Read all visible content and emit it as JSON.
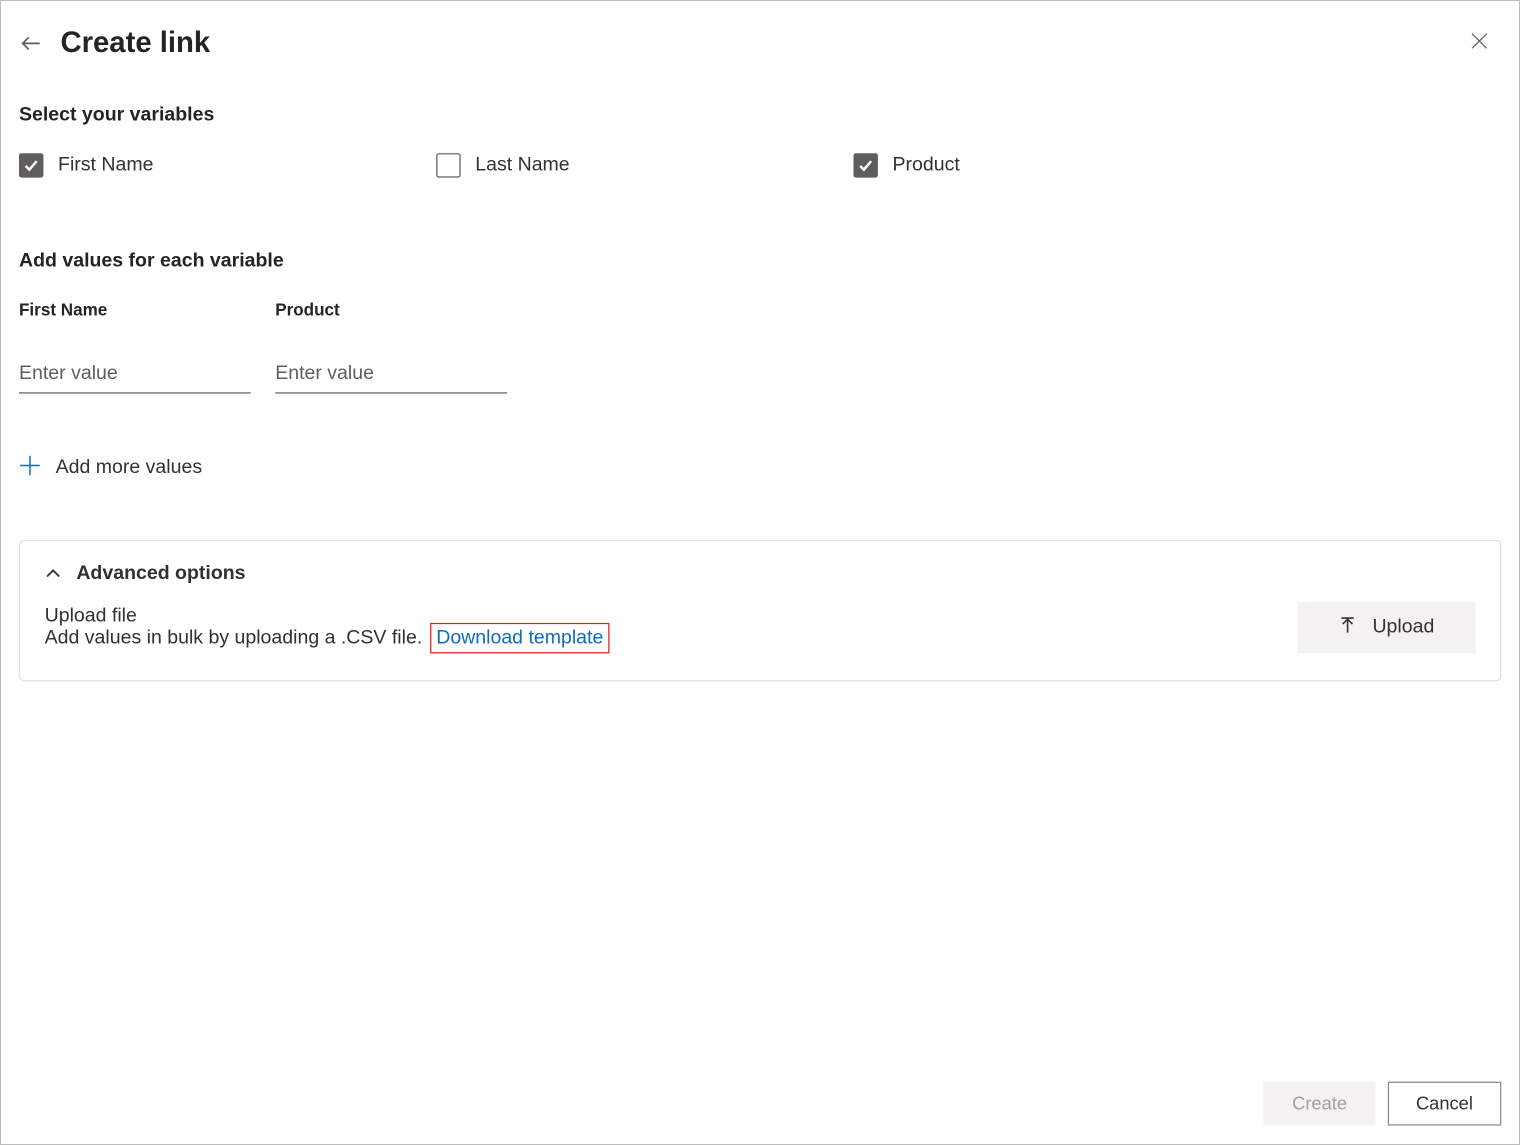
{
  "header": {
    "title": "Create link"
  },
  "sections": {
    "select_variables": "Select your variables",
    "add_values": "Add values for each variable"
  },
  "variables": [
    {
      "label": "First Name",
      "checked": true
    },
    {
      "label": "Last Name",
      "checked": false
    },
    {
      "label": "Product",
      "checked": true
    }
  ],
  "value_columns": [
    {
      "header": "First Name",
      "placeholder": "Enter value",
      "value": ""
    },
    {
      "header": "Product",
      "placeholder": "Enter value",
      "value": ""
    }
  ],
  "actions": {
    "add_more": "Add more values"
  },
  "advanced": {
    "title": "Advanced options",
    "upload_label": "Upload file",
    "bulk_text": "Add values in bulk by uploading a .CSV file.",
    "download_template": "Download template",
    "upload_button": "Upload"
  },
  "footer": {
    "create": "Create",
    "cancel": "Cancel"
  }
}
